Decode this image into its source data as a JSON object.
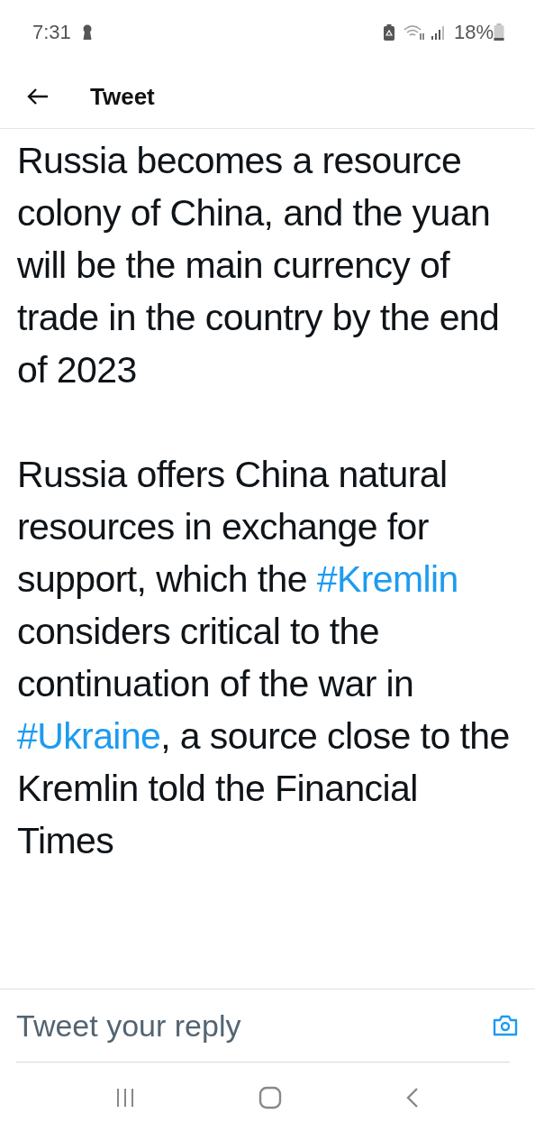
{
  "status_bar": {
    "time": "7:31",
    "battery": "18%"
  },
  "header": {
    "title": "Tweet"
  },
  "tweet": {
    "paragraphs": [
      {
        "segments": [
          {
            "kind": "text",
            "text": "Russia becomes a resource colony of China, and the yuan will be the main currency of trade in the country by the end of 2023"
          }
        ]
      },
      {
        "segments": [
          {
            "kind": "text",
            "text": "Russia offers China natural resources in exchange for support, which the "
          },
          {
            "kind": "hashtag",
            "text": "#Kremlin"
          },
          {
            "kind": "text",
            "text": " considers critical to the continuation of the war in "
          },
          {
            "kind": "hashtag",
            "text": "#Ukraine"
          },
          {
            "kind": "text",
            "text": ", a source close to the Kremlin told the Financial Times"
          }
        ]
      }
    ]
  },
  "reply_bar": {
    "placeholder": "Tweet your reply"
  }
}
